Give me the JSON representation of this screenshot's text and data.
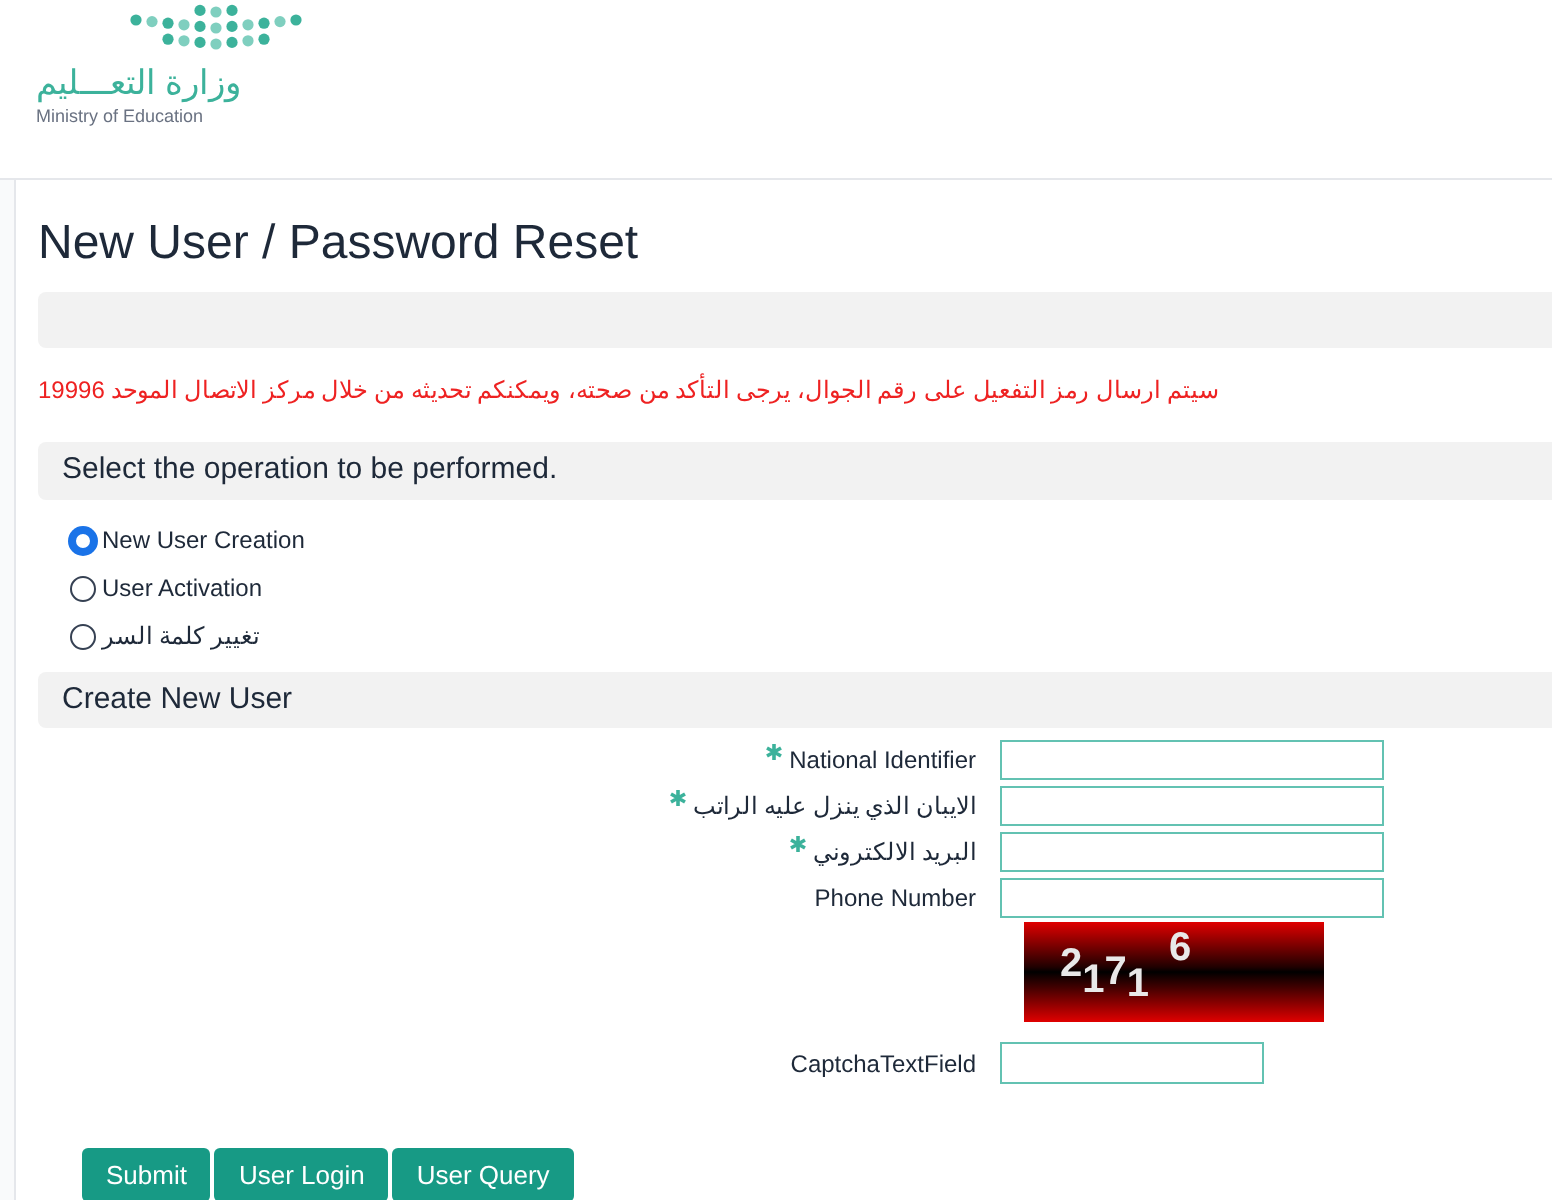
{
  "logo": {
    "name_ar": "وزارة التعـــليم",
    "name_en": "Ministry of Education"
  },
  "page_title": "New User / Password Reset",
  "notice": "سيتم ارسال رمز التفعيل على رقم الجوال، يرجى التأكد من صحته، ويمكنكم تحديثه من خلال مركز الاتصال الموحد 19996",
  "operation_section": {
    "title": "Select the operation to be performed.",
    "options": [
      {
        "label": "New User Creation",
        "selected": true
      },
      {
        "label": "User Activation",
        "selected": false
      },
      {
        "label": "تغيير كلمة السر",
        "selected": false
      }
    ]
  },
  "create_section": {
    "title": "Create New User",
    "fields": [
      {
        "label": "National Identifier",
        "required": true
      },
      {
        "label": "الايبان الذي ينزل عليه الراتب",
        "required": true
      },
      {
        "label": "البريد الالكتروني",
        "required": true
      },
      {
        "label": "Phone Number",
        "required": false
      }
    ],
    "captcha": {
      "text": "21716"
    },
    "captcha_field": {
      "label": "CaptchaTextField"
    }
  },
  "buttons": [
    "Submit",
    "User Login",
    "User Query"
  ]
}
